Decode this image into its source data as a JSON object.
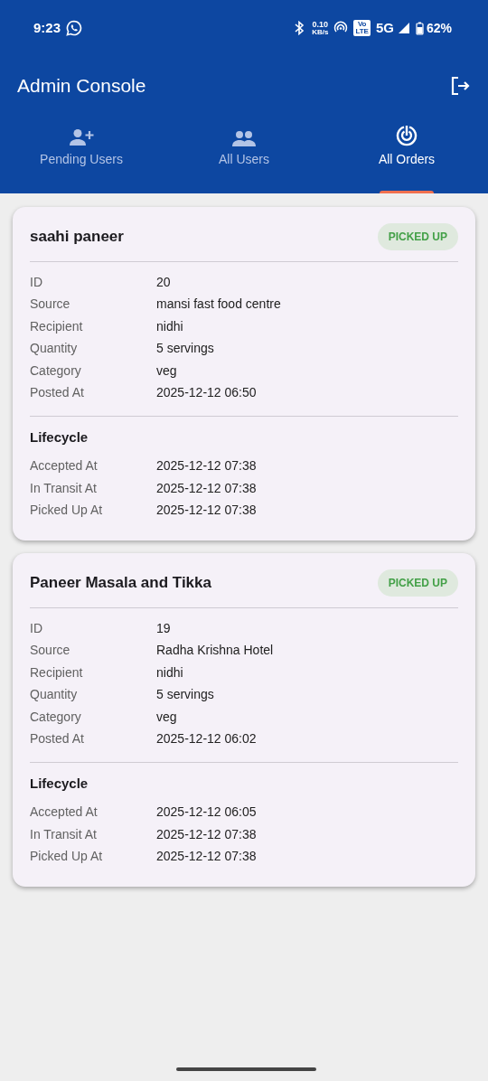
{
  "status_bar": {
    "time": "9:23",
    "net_speed": "0.10",
    "net_unit": "KB/s",
    "volte_top": "Vo",
    "volte_bottom": "LTE",
    "network": "5G",
    "battery": "62%"
  },
  "app_bar": {
    "title": "Admin Console"
  },
  "tabs": [
    {
      "label": "Pending Users",
      "kind": "person-add",
      "selected": false
    },
    {
      "label": "All Users",
      "kind": "people",
      "selected": false
    },
    {
      "label": "All Orders",
      "kind": "orders",
      "selected": true
    }
  ],
  "orders": [
    {
      "title": "saahi paneer",
      "status": "PICKED UP",
      "details": [
        {
          "label": "ID",
          "value": "20"
        },
        {
          "label": "Source",
          "value": "mansi fast food centre"
        },
        {
          "label": "Recipient",
          "value": "nidhi"
        },
        {
          "label": "Quantity",
          "value": "5 servings"
        },
        {
          "label": "Category",
          "value": "veg"
        },
        {
          "label": "Posted At",
          "value": "2025-12-12 06:50"
        }
      ],
      "lifecycle_title": "Lifecycle",
      "lifecycle": [
        {
          "label": "Accepted At",
          "value": "2025-12-12 07:38"
        },
        {
          "label": "In Transit At",
          "value": "2025-12-12 07:38"
        },
        {
          "label": "Picked Up At",
          "value": "2025-12-12 07:38"
        }
      ]
    },
    {
      "title": "Paneer Masala and Tikka",
      "status": "PICKED UP",
      "details": [
        {
          "label": "ID",
          "value": "19"
        },
        {
          "label": "Source",
          "value": "Radha Krishna Hotel"
        },
        {
          "label": "Recipient",
          "value": "nidhi"
        },
        {
          "label": "Quantity",
          "value": "5 servings"
        },
        {
          "label": "Category",
          "value": "veg"
        },
        {
          "label": "Posted At",
          "value": "2025-12-12 06:02"
        }
      ],
      "lifecycle_title": "Lifecycle",
      "lifecycle": [
        {
          "label": "Accepted At",
          "value": "2025-12-12 06:05"
        },
        {
          "label": "In Transit At",
          "value": "2025-12-12 07:38"
        },
        {
          "label": "Picked Up At",
          "value": "2025-12-12 07:38"
        }
      ]
    }
  ]
}
